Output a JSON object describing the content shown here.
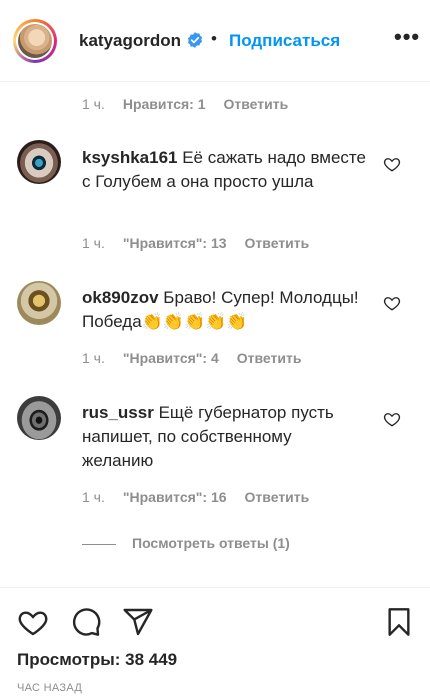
{
  "header": {
    "username": "katyagordon",
    "separator": "•",
    "follow_label": "Подписаться",
    "more_label": "•••",
    "verified_color": "#3897f0"
  },
  "comments": {
    "top_meta": {
      "time": "1 ч.",
      "likes": "Нравится: 1",
      "reply": "Ответить"
    },
    "items": [
      {
        "username": "ksyshka161",
        "text": "Её сажать надо вместе с Голубем а она просто ушла",
        "time": "1 ч.",
        "likes": "\"Нравится\": 13",
        "reply": "Ответить"
      },
      {
        "username": "ok890zov",
        "text": "Браво! Супер! Молодцы! Победа👏👏👏👏👏",
        "time": "1 ч.",
        "likes": "\"Нравится\": 4",
        "reply": "Ответить"
      },
      {
        "username": "rus_ussr",
        "text": "Ещё губернатор пусть напишет, по собственному желанию",
        "time": "1 ч.",
        "likes": "\"Нравится\": 16",
        "reply": "Ответить"
      }
    ],
    "view_replies": "Посмотреть ответы (1)"
  },
  "actions": {
    "icons": [
      "heart-icon",
      "comment-icon",
      "share-icon",
      "bookmark-icon"
    ],
    "views": "Просмотры: 38 449",
    "time_ago": "ЧАС НАЗАД"
  },
  "colors": {
    "accent": "#0095f6",
    "text": "#262626",
    "muted": "#8e8e8e"
  }
}
